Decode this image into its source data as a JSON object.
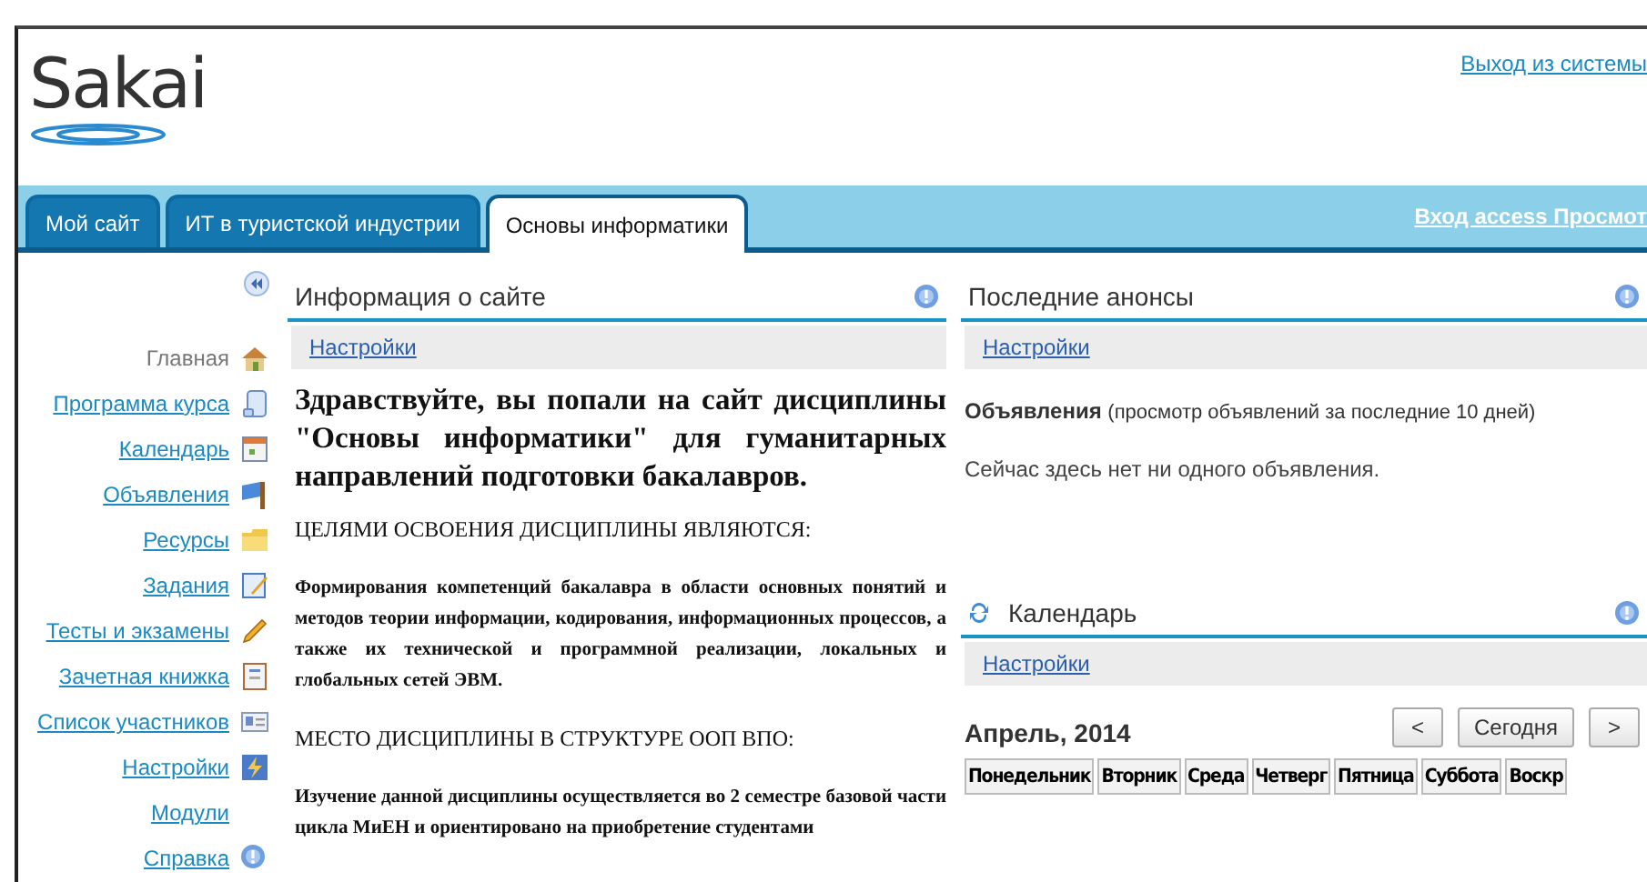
{
  "header": {
    "logo": "Sakai",
    "logout": "Выход из системы"
  },
  "tabs": [
    {
      "label": "Мой сайт",
      "selected": false
    },
    {
      "label": "ИТ в туристской индустрии",
      "selected": false
    },
    {
      "label": "Основы информатики",
      "selected": true
    }
  ],
  "tab_bar_link": "Вход access Просмот",
  "nav": {
    "items": [
      {
        "label": "Главная",
        "kind": "home",
        "selected": true
      },
      {
        "label": "Программа курса",
        "kind": "syllabus",
        "selected": false
      },
      {
        "label": "Календарь",
        "kind": "calendar",
        "selected": false
      },
      {
        "label": "Объявления",
        "kind": "flag",
        "selected": false
      },
      {
        "label": "Ресурсы",
        "kind": "folder",
        "selected": false
      },
      {
        "label": "Задания",
        "kind": "assignment",
        "selected": false
      },
      {
        "label": "Тесты и экзамены",
        "kind": "pencil",
        "selected": false
      },
      {
        "label": "Зачетная книжка",
        "kind": "gradebook",
        "selected": false
      },
      {
        "label": "Список участников",
        "kind": "roster",
        "selected": false
      },
      {
        "label": "Настройки",
        "kind": "settings",
        "selected": false
      },
      {
        "label": "Модули",
        "kind": "none",
        "selected": false
      },
      {
        "label": "Справка",
        "kind": "help",
        "selected": false
      }
    ]
  },
  "site_info": {
    "title": "Информация о сайте",
    "settings": "Настройки",
    "heading": "Здравствуйте, вы попали на сайт дисциплины \"Основы информатики\" для гуманитарных направлений подготовки бакалавров.",
    "blocks": [
      {
        "kind": "caps",
        "text": "ЦЕЛЯМИ ОСВОЕНИЯ ДИСЦИПЛИНЫ ЯВЛЯЮТСЯ:"
      },
      {
        "kind": "para",
        "text": "Формирования компетенций бакалавра в области основных понятий и методов теории информации, кодирования, информационных процессов, а также их технической и программной реализации, локальных и глобальных сетей ЭВМ."
      },
      {
        "kind": "caps",
        "text": "МЕСТО ДИСЦИПЛИНЫ В СТРУКТУРЕ ООП ВПО:"
      },
      {
        "kind": "para",
        "text": "Изучение данной дисциплины осуществляется во 2 семестре базовой части цикла МиЕН и ориентировано на приобретение студентами"
      }
    ]
  },
  "announcements": {
    "title": "Последние анонсы",
    "settings": "Настройки",
    "label": "Объявления",
    "label_note": "(просмотр объявлений за последние 10 дней)",
    "empty": "Сейчас здесь нет ни одного объявления."
  },
  "calendar": {
    "title": "Календарь",
    "settings": "Настройки",
    "month": "Апрель, 2014",
    "buttons": [
      "<",
      "Сегодня",
      ">"
    ],
    "columns": [
      "Понедельник",
      "Вторник",
      "Среда",
      "Четверг",
      "Пятница",
      "Суббота",
      "Воскр"
    ]
  }
}
